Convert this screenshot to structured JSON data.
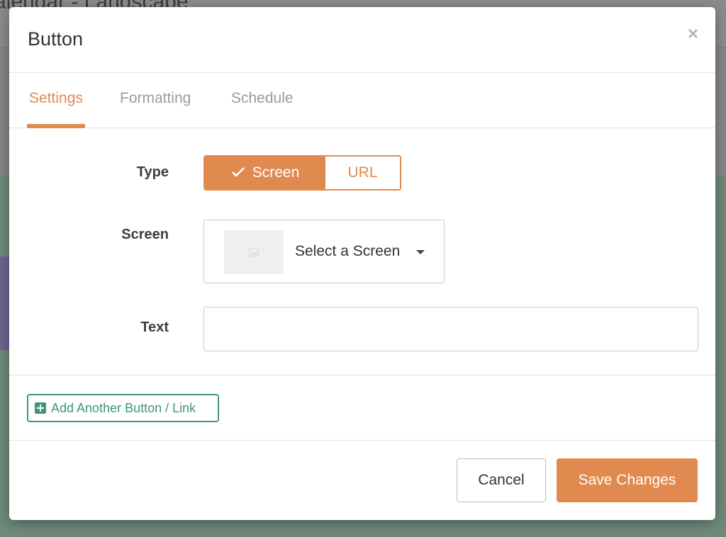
{
  "background": {
    "title": "alendar - Landscape"
  },
  "modal": {
    "title": "Button",
    "close_icon": "×",
    "tabs": [
      {
        "label": "Settings",
        "active": true
      },
      {
        "label": "Formatting",
        "active": false
      },
      {
        "label": "Schedule",
        "active": false
      }
    ],
    "form": {
      "type_label": "Type",
      "type_options": [
        {
          "label": "Screen",
          "selected": true
        },
        {
          "label": "URL",
          "selected": false
        }
      ],
      "screen_label": "Screen",
      "screen_select_text": "Select a Screen",
      "text_label": "Text",
      "text_value": ""
    },
    "add_button_label": "Add Another Button / Link",
    "footer": {
      "cancel_label": "Cancel",
      "save_label": "Save Changes"
    }
  },
  "colors": {
    "accent": "#e08a4f",
    "green": "#3e9677"
  },
  "icons": {
    "close": "close-icon",
    "check": "check-icon",
    "caret": "caret-down-icon",
    "image": "image-placeholder-icon",
    "plus": "plus-square-icon"
  }
}
